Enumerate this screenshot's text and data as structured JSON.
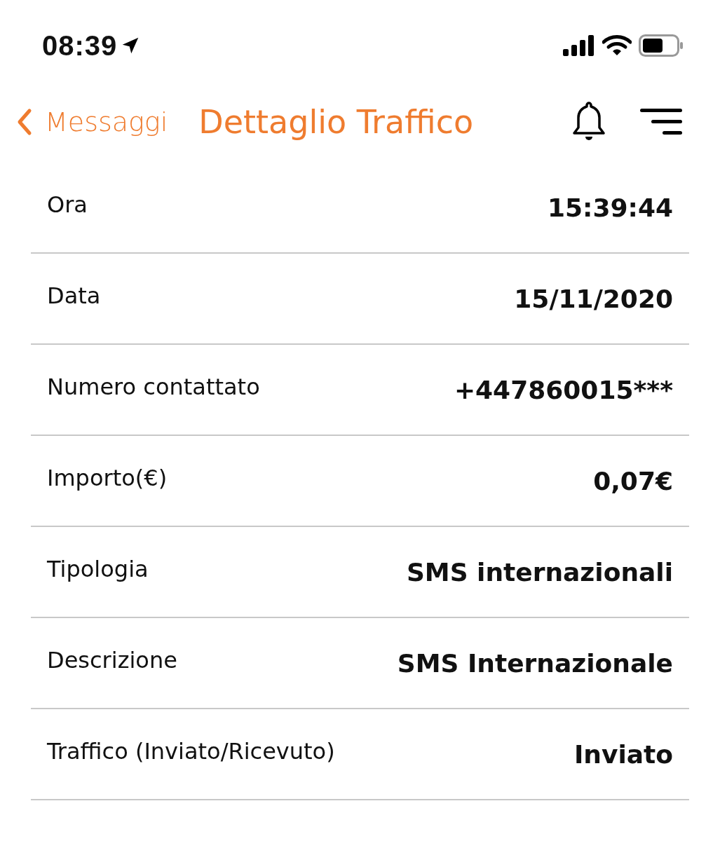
{
  "status_bar": {
    "time": "08:39"
  },
  "nav": {
    "back": "Messaggi",
    "title": "Dettaglio Traffico"
  },
  "details": [
    {
      "label": "Ora",
      "value": "15:39:44"
    },
    {
      "label": "Data",
      "value": "15/11/2020"
    },
    {
      "label": "Numero contattato",
      "value": "+447860015***"
    },
    {
      "label": "Importo(€)",
      "value": "0,07€"
    },
    {
      "label": "Tipologia",
      "value": "SMS internazionali"
    },
    {
      "label": "Descrizione",
      "value": "SMS Internazionale"
    },
    {
      "label": "Traffico (Inviato/Ricevuto)",
      "value": "Inviato"
    }
  ]
}
